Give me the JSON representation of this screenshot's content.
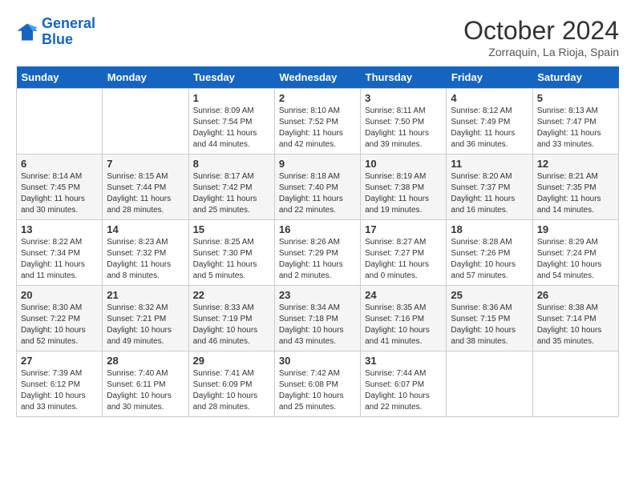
{
  "header": {
    "logo_line1": "General",
    "logo_line2": "Blue",
    "month": "October 2024",
    "location": "Zorraquin, La Rioja, Spain"
  },
  "days_of_week": [
    "Sunday",
    "Monday",
    "Tuesday",
    "Wednesday",
    "Thursday",
    "Friday",
    "Saturday"
  ],
  "weeks": [
    [
      {
        "day": "",
        "info": ""
      },
      {
        "day": "",
        "info": ""
      },
      {
        "day": "1",
        "info": "Sunrise: 8:09 AM\nSunset: 7:54 PM\nDaylight: 11 hours and 44 minutes."
      },
      {
        "day": "2",
        "info": "Sunrise: 8:10 AM\nSunset: 7:52 PM\nDaylight: 11 hours and 42 minutes."
      },
      {
        "day": "3",
        "info": "Sunrise: 8:11 AM\nSunset: 7:50 PM\nDaylight: 11 hours and 39 minutes."
      },
      {
        "day": "4",
        "info": "Sunrise: 8:12 AM\nSunset: 7:49 PM\nDaylight: 11 hours and 36 minutes."
      },
      {
        "day": "5",
        "info": "Sunrise: 8:13 AM\nSunset: 7:47 PM\nDaylight: 11 hours and 33 minutes."
      }
    ],
    [
      {
        "day": "6",
        "info": "Sunrise: 8:14 AM\nSunset: 7:45 PM\nDaylight: 11 hours and 30 minutes."
      },
      {
        "day": "7",
        "info": "Sunrise: 8:15 AM\nSunset: 7:44 PM\nDaylight: 11 hours and 28 minutes."
      },
      {
        "day": "8",
        "info": "Sunrise: 8:17 AM\nSunset: 7:42 PM\nDaylight: 11 hours and 25 minutes."
      },
      {
        "day": "9",
        "info": "Sunrise: 8:18 AM\nSunset: 7:40 PM\nDaylight: 11 hours and 22 minutes."
      },
      {
        "day": "10",
        "info": "Sunrise: 8:19 AM\nSunset: 7:38 PM\nDaylight: 11 hours and 19 minutes."
      },
      {
        "day": "11",
        "info": "Sunrise: 8:20 AM\nSunset: 7:37 PM\nDaylight: 11 hours and 16 minutes."
      },
      {
        "day": "12",
        "info": "Sunrise: 8:21 AM\nSunset: 7:35 PM\nDaylight: 11 hours and 14 minutes."
      }
    ],
    [
      {
        "day": "13",
        "info": "Sunrise: 8:22 AM\nSunset: 7:34 PM\nDaylight: 11 hours and 11 minutes."
      },
      {
        "day": "14",
        "info": "Sunrise: 8:23 AM\nSunset: 7:32 PM\nDaylight: 11 hours and 8 minutes."
      },
      {
        "day": "15",
        "info": "Sunrise: 8:25 AM\nSunset: 7:30 PM\nDaylight: 11 hours and 5 minutes."
      },
      {
        "day": "16",
        "info": "Sunrise: 8:26 AM\nSunset: 7:29 PM\nDaylight: 11 hours and 2 minutes."
      },
      {
        "day": "17",
        "info": "Sunrise: 8:27 AM\nSunset: 7:27 PM\nDaylight: 11 hours and 0 minutes."
      },
      {
        "day": "18",
        "info": "Sunrise: 8:28 AM\nSunset: 7:26 PM\nDaylight: 10 hours and 57 minutes."
      },
      {
        "day": "19",
        "info": "Sunrise: 8:29 AM\nSunset: 7:24 PM\nDaylight: 10 hours and 54 minutes."
      }
    ],
    [
      {
        "day": "20",
        "info": "Sunrise: 8:30 AM\nSunset: 7:22 PM\nDaylight: 10 hours and 52 minutes."
      },
      {
        "day": "21",
        "info": "Sunrise: 8:32 AM\nSunset: 7:21 PM\nDaylight: 10 hours and 49 minutes."
      },
      {
        "day": "22",
        "info": "Sunrise: 8:33 AM\nSunset: 7:19 PM\nDaylight: 10 hours and 46 minutes."
      },
      {
        "day": "23",
        "info": "Sunrise: 8:34 AM\nSunset: 7:18 PM\nDaylight: 10 hours and 43 minutes."
      },
      {
        "day": "24",
        "info": "Sunrise: 8:35 AM\nSunset: 7:16 PM\nDaylight: 10 hours and 41 minutes."
      },
      {
        "day": "25",
        "info": "Sunrise: 8:36 AM\nSunset: 7:15 PM\nDaylight: 10 hours and 38 minutes."
      },
      {
        "day": "26",
        "info": "Sunrise: 8:38 AM\nSunset: 7:14 PM\nDaylight: 10 hours and 35 minutes."
      }
    ],
    [
      {
        "day": "27",
        "info": "Sunrise: 7:39 AM\nSunset: 6:12 PM\nDaylight: 10 hours and 33 minutes."
      },
      {
        "day": "28",
        "info": "Sunrise: 7:40 AM\nSunset: 6:11 PM\nDaylight: 10 hours and 30 minutes."
      },
      {
        "day": "29",
        "info": "Sunrise: 7:41 AM\nSunset: 6:09 PM\nDaylight: 10 hours and 28 minutes."
      },
      {
        "day": "30",
        "info": "Sunrise: 7:42 AM\nSunset: 6:08 PM\nDaylight: 10 hours and 25 minutes."
      },
      {
        "day": "31",
        "info": "Sunrise: 7:44 AM\nSunset: 6:07 PM\nDaylight: 10 hours and 22 minutes."
      },
      {
        "day": "",
        "info": ""
      },
      {
        "day": "",
        "info": ""
      }
    ]
  ]
}
